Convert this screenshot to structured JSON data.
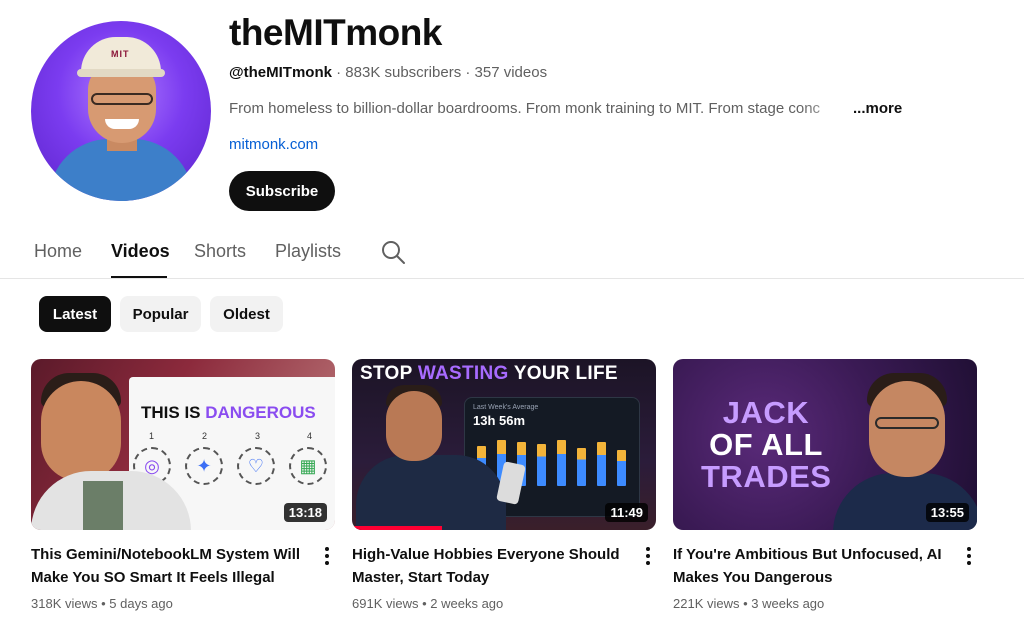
{
  "channel": {
    "title": "theMITmonk",
    "handle": "@theMITmonk",
    "stats": " · 883K subscribers · 357 videos",
    "description": "From homeless to billion-dollar boardrooms. From monk training to MIT. From stage conc",
    "more_label": "...more",
    "link": "mitmonk.com",
    "subscribe_label": "Subscribe",
    "avatar_cap_text": "MIT"
  },
  "tabs": [
    {
      "label": "Home"
    },
    {
      "label": "Videos"
    },
    {
      "label": "Shorts"
    },
    {
      "label": "Playlists"
    }
  ],
  "active_tab": "Videos",
  "chips": [
    {
      "label": "Latest"
    },
    {
      "label": "Popular"
    },
    {
      "label": "Oldest"
    }
  ],
  "active_chip": "Latest",
  "videos": [
    {
      "title": "This Gemini/NotebookLM System Will Make You SO Smart It Feels Illegal",
      "views": "318K views",
      "age": "5 days ago",
      "duration": "13:18",
      "thumb_text_a": "THIS IS ",
      "thumb_text_b": "DANGEROUS",
      "thumb_nums": [
        "1",
        "2",
        "3",
        "4"
      ]
    },
    {
      "title": "High-Value Hobbies Everyone Should Master, Start Today",
      "views": "691K views",
      "age": "2 weeks ago",
      "duration": "11:49",
      "thumb_text_a": "STOP ",
      "thumb_text_b": "WASTING",
      "thumb_text_c": " YOUR LIFE",
      "panel_small": "Last Week's Average",
      "panel_big": "13h 56m"
    },
    {
      "title": "If You're Ambitious But Unfocused, AI Makes You Dangerous",
      "views": "221K views",
      "age": "3 weeks ago",
      "duration": "13:55",
      "thumb_line1": "JACK",
      "thumb_line2": "OF ALL",
      "thumb_line3": "TRADES"
    }
  ],
  "meta_separator": " • "
}
